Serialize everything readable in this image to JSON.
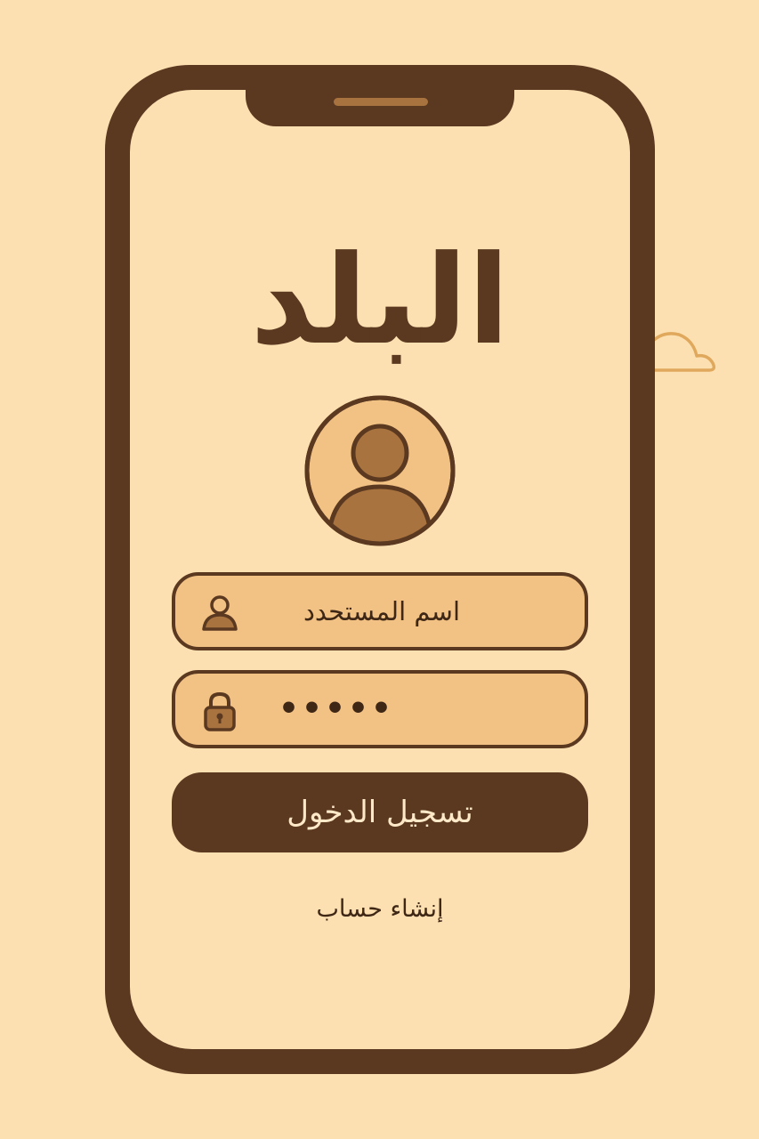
{
  "app": {
    "title": "البلد"
  },
  "login_form": {
    "username_placeholder": "اسم المستحدد",
    "password_value": "•••••",
    "login_button": "تسجيل الدخول",
    "create_account_link": "إنشاء حساب"
  },
  "icons": {
    "avatar": "user-avatar-icon",
    "username": "user-icon",
    "password": "lock-icon",
    "decoration": "cloud-icon"
  },
  "colors": {
    "background": "#fde0b1",
    "frame": "#5a3920",
    "field_fill": "#f2c184",
    "accent": "#a8733f",
    "cloud_stroke": "#e0a85c"
  }
}
